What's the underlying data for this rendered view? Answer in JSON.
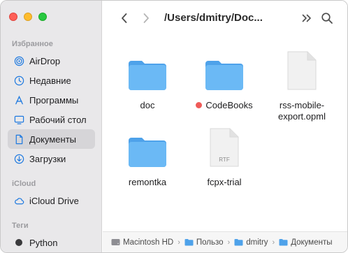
{
  "sidebar": {
    "sections": [
      {
        "title": "Избранное",
        "items": [
          {
            "label": "AirDrop",
            "icon": "airdrop-icon"
          },
          {
            "label": "Недавние",
            "icon": "clock-icon"
          },
          {
            "label": "Программы",
            "icon": "applications-icon"
          },
          {
            "label": "Рабочий стол",
            "icon": "desktop-icon"
          },
          {
            "label": "Документы",
            "icon": "document-icon",
            "selected": true
          },
          {
            "label": "Загрузки",
            "icon": "download-icon"
          }
        ]
      },
      {
        "title": "iCloud",
        "items": [
          {
            "label": "iCloud Drive",
            "icon": "cloud-icon"
          }
        ]
      },
      {
        "title": "Теги",
        "items": [
          {
            "label": "Python",
            "icon": "tag-dot"
          }
        ]
      }
    ]
  },
  "toolbar": {
    "path_title": "/Users/dmitry/Doc..."
  },
  "files": [
    {
      "name": "doc",
      "type": "folder"
    },
    {
      "name": "CodeBooks",
      "type": "folder",
      "tag_color": "#ef5b58"
    },
    {
      "name": "rss-mobile-export.opml",
      "type": "file"
    },
    {
      "name": "remontka",
      "type": "folder"
    },
    {
      "name": "fcpx-trial",
      "type": "rtf-file",
      "badge": "RTF"
    }
  ],
  "pathbar": [
    {
      "label": "Macintosh HD",
      "icon": "disk-icon"
    },
    {
      "label": "Пользо",
      "icon": "folder-icon"
    },
    {
      "label": "dmitry",
      "icon": "folder-icon"
    },
    {
      "label": "Документы",
      "icon": "folder-icon"
    }
  ],
  "colors": {
    "accent": "#1f7ae0",
    "folder": "#5aaef2",
    "sidebar_bg": "#e9e8ea",
    "selected_bg": "#d6d5d8"
  }
}
